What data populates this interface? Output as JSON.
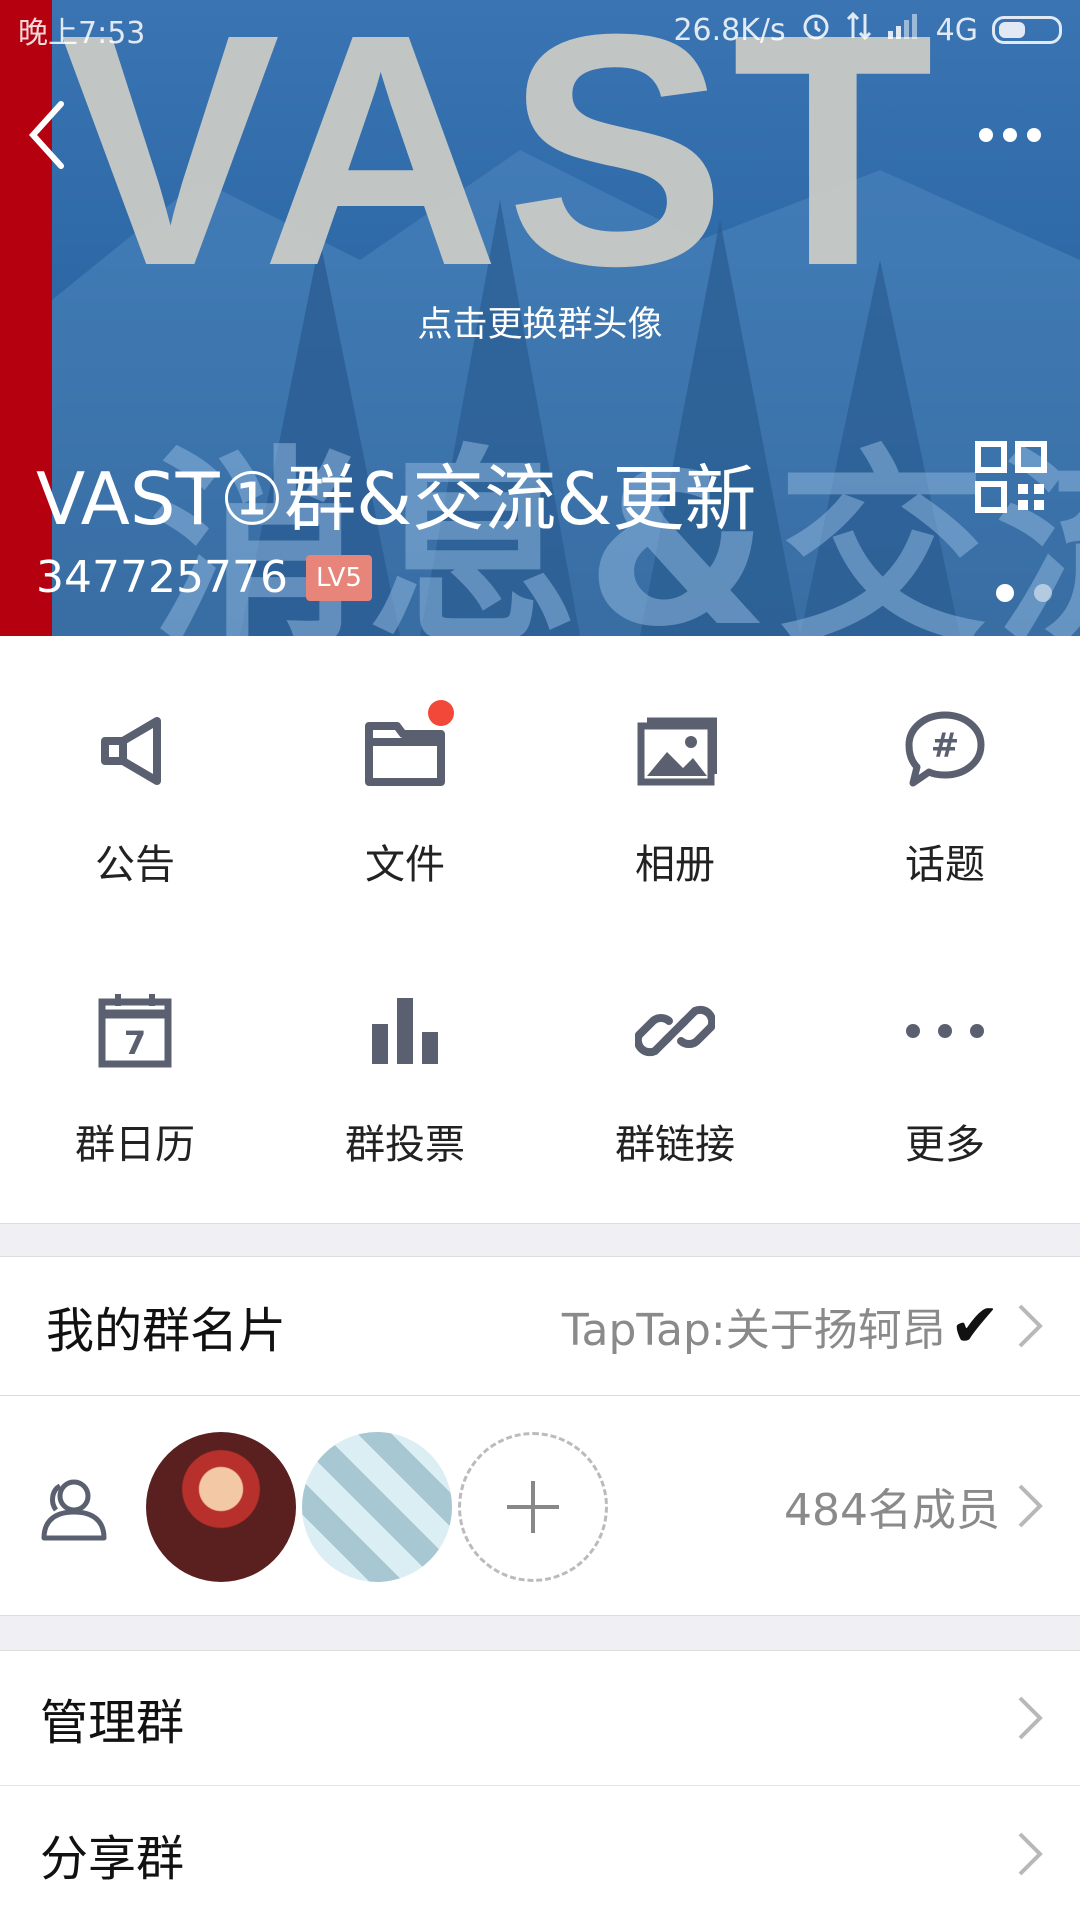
{
  "status_bar": {
    "time": "晚上7:53",
    "speed": "26.8K/s",
    "network": "4G",
    "icons": [
      "alarm-icon",
      "data-transfer-icon",
      "signal-icon",
      "battery-icon"
    ]
  },
  "header": {
    "banner_text": "VAST",
    "banner_subtext": "消息&交流",
    "change_avatar_hint": "点击更换群头像",
    "group_name": "VAST①群&交流&更新",
    "group_id": "347725776",
    "level_badge": "LV5",
    "pager": {
      "pages": 2,
      "current": 1
    }
  },
  "features": [
    {
      "label": "公告",
      "icon": "announcement-icon"
    },
    {
      "label": "文件",
      "icon": "folder-icon",
      "badge": true
    },
    {
      "label": "相册",
      "icon": "album-icon"
    },
    {
      "label": "话题",
      "icon": "topic-icon"
    },
    {
      "label": "群日历",
      "icon": "calendar-icon",
      "calendar_day": "7"
    },
    {
      "label": "群投票",
      "icon": "poll-icon"
    },
    {
      "label": "群链接",
      "icon": "link-icon"
    },
    {
      "label": "更多",
      "icon": "more-icon"
    }
  ],
  "card_row": {
    "title": "我的群名片",
    "value": "TapTap:关于扬轲昂",
    "check_mark": "✔"
  },
  "members_row": {
    "count_text": "484名成员"
  },
  "rows": {
    "manage": "管理群",
    "share": "分享群"
  },
  "colors": {
    "accent_red": "#b5000f",
    "badge_red": "#f2483a",
    "icon_gray": "#5b6070",
    "text_gray": "#8a8a8a"
  }
}
